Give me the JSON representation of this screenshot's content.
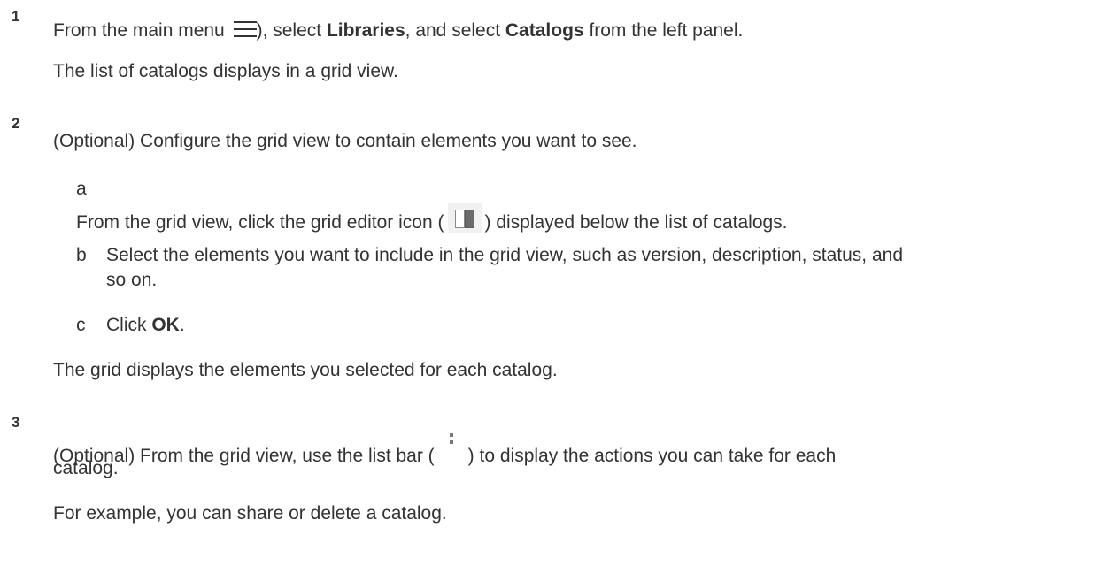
{
  "steps": [
    {
      "number": "1",
      "line1": {
        "prefix": "From the main menu ",
        "icon": "hamburger-menu-icon",
        "after_icon": "), select ",
        "bold1": "Libraries",
        "middle": ", and select ",
        "bold2": "Catalogs",
        "suffix": " from the left panel."
      },
      "result": "The list of catalogs displays in a grid view."
    },
    {
      "number": "2",
      "text": "(Optional) Configure the grid view to contain elements you want to see.",
      "substeps": [
        {
          "letter": "a",
          "before_icon": "From the grid view, click the grid editor icon (",
          "icon": "grid-editor-icon",
          "after_icon": ") displayed below the list of catalogs."
        },
        {
          "letter": "b",
          "line1": "Select the elements you want to include in the grid view, such as version, description, status, and",
          "line2": "so on."
        },
        {
          "letter": "c",
          "prefix": "Click ",
          "bold": "OK",
          "suffix": "."
        }
      ],
      "result": "The grid displays the elements you selected for each catalog."
    },
    {
      "number": "3",
      "before_icon": "(Optional) From the grid view, use the list bar (",
      "icon": "list-bar-dots-icon",
      "after_icon": ") to display the actions you can take for each",
      "line2": "catalog.",
      "result": "For example, you can share or delete a catalog."
    }
  ]
}
